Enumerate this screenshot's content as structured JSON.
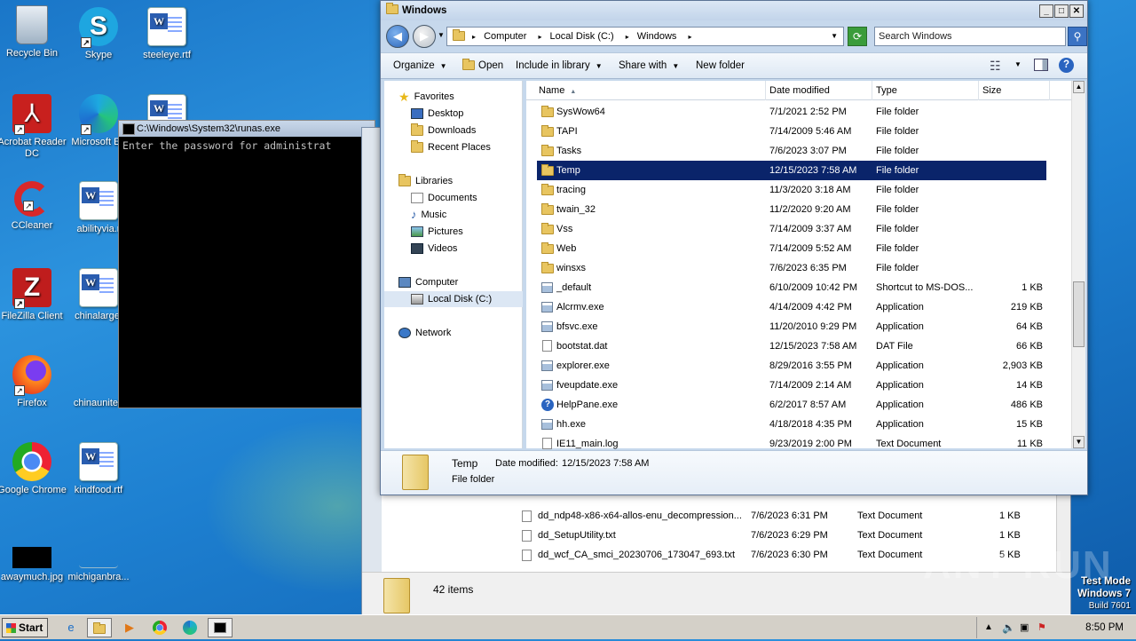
{
  "desktop": {
    "icons": [
      {
        "label": "Recycle Bin"
      },
      {
        "label": "Skype"
      },
      {
        "label": "steeleye.rtf"
      },
      {
        "label": "Acrobat Reader DC"
      },
      {
        "label": "Microsoft Ed"
      },
      {
        "label": "CCleaner"
      },
      {
        "label": "abilityvia.r"
      },
      {
        "label": "FileZilla Client"
      },
      {
        "label": "chinalarge."
      },
      {
        "label": "Firefox"
      },
      {
        "label": "chinaunited"
      },
      {
        "label": "Google Chrome"
      },
      {
        "label": "kindfood.rtf"
      },
      {
        "label": "awaymuch.jpg"
      },
      {
        "label": "michiganbra..."
      }
    ]
  },
  "console": {
    "title": "C:\\Windows\\System32\\runas.exe",
    "text": "Enter the password for administrat"
  },
  "back_window": {
    "rows": [
      {
        "name": "dd_ndp48-x86-x64-allos-enu_decompression...",
        "date": "7/6/2023 6:31 PM",
        "type": "Text Document",
        "size": "1 KB"
      },
      {
        "name": "dd_SetupUtility.txt",
        "date": "7/6/2023 6:29 PM",
        "type": "Text Document",
        "size": "1 KB"
      },
      {
        "name": "dd_wcf_CA_smci_20230706_173047_693.txt",
        "date": "7/6/2023 6:30 PM",
        "type": "Text Document",
        "size": "5 KB"
      }
    ],
    "status": "42 items"
  },
  "explorer": {
    "title": "Windows",
    "breadcrumb": [
      "Computer",
      "Local Disk (C:)",
      "Windows"
    ],
    "search_placeholder": "Search Windows",
    "toolbar": {
      "organize": "Organize",
      "open": "Open",
      "include": "Include in library",
      "share": "Share with",
      "new_folder": "New folder"
    },
    "nav": {
      "favorites": "Favorites",
      "desktop": "Desktop",
      "downloads": "Downloads",
      "recent": "Recent Places",
      "libraries": "Libraries",
      "documents": "Documents",
      "music": "Music",
      "pictures": "Pictures",
      "videos": "Videos",
      "computer": "Computer",
      "local_disk": "Local Disk (C:)",
      "network": "Network"
    },
    "columns": {
      "name": "Name",
      "date": "Date modified",
      "type": "Type",
      "size": "Size"
    },
    "files": [
      {
        "name": "SysWow64",
        "date": "7/1/2021 2:52 PM",
        "type": "File folder",
        "size": "",
        "icon": "folder"
      },
      {
        "name": "TAPI",
        "date": "7/14/2009 5:46 AM",
        "type": "File folder",
        "size": "",
        "icon": "folder"
      },
      {
        "name": "Tasks",
        "date": "7/6/2023 3:07 PM",
        "type": "File folder",
        "size": "",
        "icon": "folder"
      },
      {
        "name": "Temp",
        "date": "12/15/2023 7:58 AM",
        "type": "File folder",
        "size": "",
        "icon": "folder"
      },
      {
        "name": "tracing",
        "date": "11/3/2020 3:18 AM",
        "type": "File folder",
        "size": "",
        "icon": "folder"
      },
      {
        "name": "twain_32",
        "date": "11/2/2020 9:20 AM",
        "type": "File folder",
        "size": "",
        "icon": "folder"
      },
      {
        "name": "Vss",
        "date": "7/14/2009 3:37 AM",
        "type": "File folder",
        "size": "",
        "icon": "folder"
      },
      {
        "name": "Web",
        "date": "7/14/2009 5:52 AM",
        "type": "File folder",
        "size": "",
        "icon": "folder"
      },
      {
        "name": "winsxs",
        "date": "7/6/2023 6:35 PM",
        "type": "File folder",
        "size": "",
        "icon": "folder"
      },
      {
        "name": "_default",
        "date": "6/10/2009 10:42 PM",
        "type": "Shortcut to MS-DOS...",
        "size": "1 KB",
        "icon": "exe"
      },
      {
        "name": "Alcrmv.exe",
        "date": "4/14/2009 4:42 PM",
        "type": "Application",
        "size": "219 KB",
        "icon": "exe"
      },
      {
        "name": "bfsvc.exe",
        "date": "11/20/2010 9:29 PM",
        "type": "Application",
        "size": "64 KB",
        "icon": "exe"
      },
      {
        "name": "bootstat.dat",
        "date": "12/15/2023 7:58 AM",
        "type": "DAT File",
        "size": "66 KB",
        "icon": "doc"
      },
      {
        "name": "explorer.exe",
        "date": "8/29/2016 3:55 PM",
        "type": "Application",
        "size": "2,903 KB",
        "icon": "exe"
      },
      {
        "name": "fveupdate.exe",
        "date": "7/14/2009 2:14 AM",
        "type": "Application",
        "size": "14 KB",
        "icon": "exe"
      },
      {
        "name": "HelpPane.exe",
        "date": "6/2/2017 8:57 AM",
        "type": "Application",
        "size": "486 KB",
        "icon": "help"
      },
      {
        "name": "hh.exe",
        "date": "4/18/2018 4:35 PM",
        "type": "Application",
        "size": "15 KB",
        "icon": "exe"
      },
      {
        "name": "IE11_main.log",
        "date": "9/23/2019 2:00 PM",
        "type": "Text Document",
        "size": "11 KB",
        "icon": "doc"
      }
    ],
    "selected_index": 3,
    "details": {
      "name": "Temp",
      "modified_label": "Date modified:",
      "modified": "12/15/2023 7:58 AM",
      "type": "File folder"
    }
  },
  "taskbar": {
    "start": "Start",
    "clock": "8:50 PM"
  },
  "watermark": {
    "line1": "Test Mode",
    "line2": "Windows 7",
    "line3": "Build 7601",
    "brand": "ANY RUN"
  }
}
